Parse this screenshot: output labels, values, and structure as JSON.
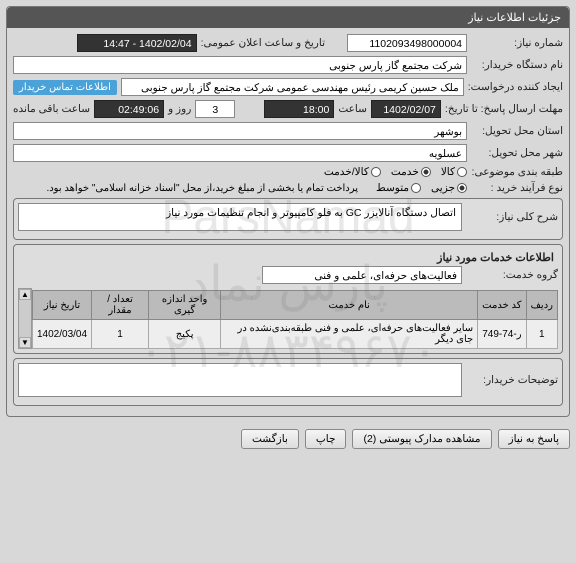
{
  "header": {
    "title": "جزئیات اطلاعات نیاز"
  },
  "req_no": {
    "label": "شماره نیاز:",
    "value": "1102093498000004"
  },
  "announce": {
    "label": "تاریخ و ساعت اعلان عمومی:",
    "value": "1402/02/04 - 14:47"
  },
  "buyer": {
    "label": "نام دستگاه خریدار:",
    "value": "شرکت مجتمع گاز پارس جنوبی"
  },
  "creator": {
    "label": "ایجاد کننده درخواست:",
    "value": "ملک حسین کریمی رئیس مهندسی عمومی  شرکت مجتمع گاز پارس جنوبی"
  },
  "contact_link": "اطلاعات تماس خریدار",
  "deadline": {
    "label": "مهلت ارسال پاسخ: تا تاریخ:",
    "date": "1402/02/07",
    "hour_label": "ساعت",
    "hour": "18:00",
    "days": "3",
    "days_label": "روز و",
    "time": "02:49:06",
    "remain_label": "ساعت باقی مانده"
  },
  "province": {
    "label": "استان محل تحویل:",
    "value": "بوشهر"
  },
  "city": {
    "label": "شهر محل تحویل:",
    "value": "عسلویه"
  },
  "subject_type": {
    "label": "طبقه بندی موضوعی:",
    "options": [
      {
        "label": "کالا",
        "checked": false
      },
      {
        "label": "خدمت",
        "checked": true
      },
      {
        "label": "کالا/خدمت",
        "checked": false
      }
    ]
  },
  "process_type": {
    "label": "نوع فرآیند خرید :",
    "options": [
      {
        "label": "جزیی",
        "checked": true
      },
      {
        "label": "متوسط",
        "checked": false
      }
    ],
    "note": "پرداخت تمام یا بخشی از مبلغ خرید،از محل \"اسناد خزانه اسلامی\" خواهد بود."
  },
  "main_desc": {
    "header": "شرح کلی نیاز:",
    "value": "اتصال دستگاه آنالایزر GC به فلو کامپیوتر و انجام تنظیمات مورد نیاز"
  },
  "services_header": "اطلاعات خدمات مورد نیاز",
  "service_group": {
    "label": "گروه خدمت:",
    "value": "فعالیت‌های حرفه‌ای، علمی و فنی"
  },
  "table": {
    "headers": [
      "ردیف",
      "کد خدمت",
      "نام خدمت",
      "واحد اندازه گیری",
      "تعداد / مقدار",
      "تاریخ نیاز"
    ],
    "rows": [
      [
        "1",
        "ر-74-749",
        "سایر فعالیت‌های حرفه‌ای، علمی و فنی طبقه‌بندی‌نشده در جای دیگر",
        "پکیج",
        "1",
        "1402/03/04"
      ]
    ]
  },
  "buyer_notes": {
    "label": "توضیحات خریدار:"
  },
  "buttons": {
    "reply": "پاسخ به نیاز",
    "attachments": "مشاهده مدارک پیوستی  (2)",
    "print": "چاپ",
    "back": "بازگشت"
  },
  "watermark": {
    "line1": "ParsNamad",
    "line2": "پارس نماد",
    "line3": "۰۲۱-۸۸۳۴۹۶۷۰"
  }
}
